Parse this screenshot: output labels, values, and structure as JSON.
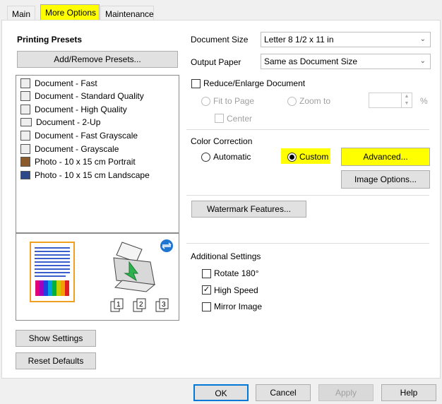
{
  "tabs": [
    {
      "label": "Main"
    },
    {
      "label": "More Options"
    },
    {
      "label": "Maintenance"
    }
  ],
  "printing_presets": {
    "heading": "Printing Presets",
    "add_remove_label": "Add/Remove Presets...",
    "items": [
      {
        "label": "Document - Fast",
        "icon": "document-icon"
      },
      {
        "label": "Document - Standard Quality",
        "icon": "document-icon"
      },
      {
        "label": "Document - High Quality",
        "icon": "document-icon"
      },
      {
        "label": "Document - 2-Up",
        "icon": "two-up-icon"
      },
      {
        "label": "Document - Fast Grayscale",
        "icon": "document-icon"
      },
      {
        "label": "Document - Grayscale",
        "icon": "document-icon"
      },
      {
        "label": "Photo - 10 x 15 cm Portrait",
        "icon": "photo-icon"
      },
      {
        "label": "Photo - 10 x 15 cm Landscape",
        "icon": "photo-landscape-icon"
      }
    ],
    "show_settings_label": "Show Settings",
    "reset_defaults_label": "Reset Defaults"
  },
  "preview": {
    "page_numbers": [
      "1",
      "2",
      "3"
    ]
  },
  "document_size": {
    "label": "Document Size",
    "value": "Letter 8 1/2 x 11 in"
  },
  "output_paper": {
    "label": "Output Paper",
    "value": "Same as Document Size"
  },
  "reduce_enlarge": {
    "label": "Reduce/Enlarge Document",
    "checked": false,
    "fit_to_page_label": "Fit to Page",
    "zoom_to_label": "Zoom to",
    "zoom_value": "",
    "percent_symbol": "%",
    "center_label": "Center"
  },
  "color_correction": {
    "heading": "Color Correction",
    "automatic_label": "Automatic",
    "custom_label": "Custom",
    "selected": "Custom",
    "advanced_label": "Advanced...",
    "image_options_label": "Image Options..."
  },
  "watermark_label": "Watermark Features...",
  "additional_settings": {
    "heading": "Additional Settings",
    "rotate_label": "Rotate 180°",
    "rotate_checked": false,
    "high_speed_label": "High Speed",
    "high_speed_checked": true,
    "mirror_label": "Mirror Image",
    "mirror_checked": false
  },
  "dialog_buttons": {
    "ok": "OK",
    "cancel": "Cancel",
    "apply": "Apply",
    "help": "Help"
  },
  "colors": {
    "highlight": "#ffff00",
    "accent_blue": "#1f76d2"
  }
}
